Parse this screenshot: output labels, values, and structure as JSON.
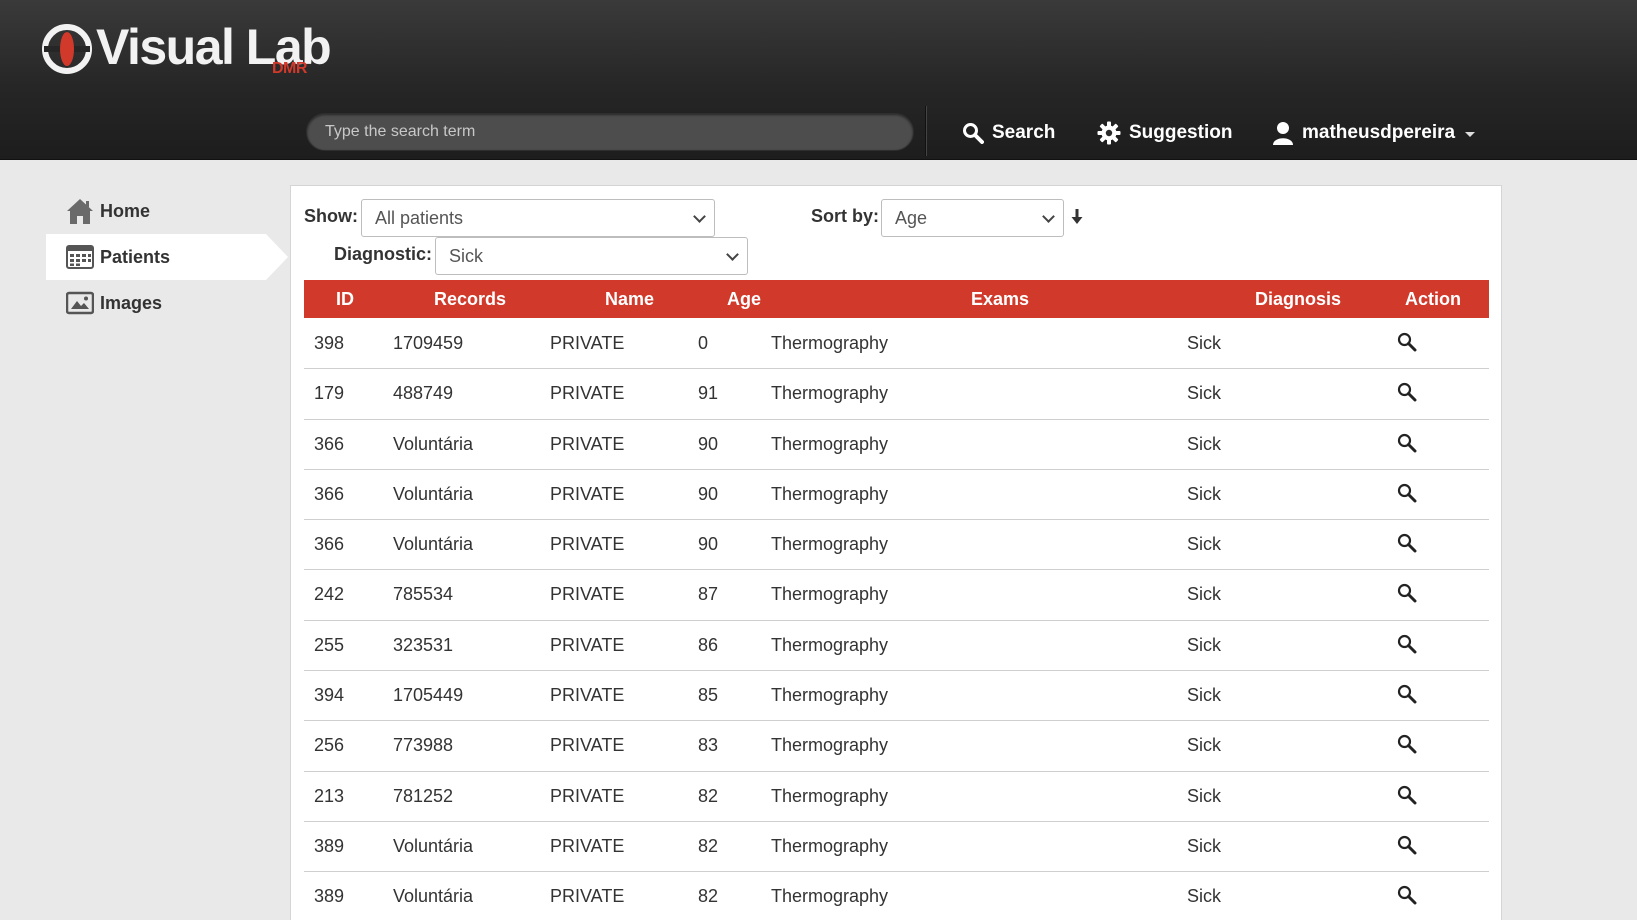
{
  "header": {
    "logo_text": "Visual Lab",
    "logo_sub": "DMR",
    "search_placeholder": "Type the search term",
    "nav": {
      "search_label": "Search",
      "suggestion_label": "Suggestion",
      "user_label": "matheusdpereira"
    }
  },
  "sidebar": {
    "items": [
      {
        "label": "Home",
        "icon": "home-icon"
      },
      {
        "label": "Patients",
        "icon": "calendar-icon",
        "active": true
      },
      {
        "label": "Images",
        "icon": "image-icon"
      }
    ]
  },
  "filters": {
    "show_label": "Show:",
    "show_value": "All patients",
    "sort_label": "Sort by:",
    "sort_value": "Age",
    "diagnostic_label": "Diagnostic:",
    "diagnostic_value": "Sick"
  },
  "table": {
    "columns": [
      "ID",
      "Records",
      "Name",
      "Age",
      "Exams",
      "Diagnosis",
      "Action"
    ],
    "rows": [
      {
        "id": "398",
        "records": "1709459",
        "name": "PRIVATE",
        "age": "0",
        "exams": "Thermography",
        "diagnosis": "Sick"
      },
      {
        "id": "179",
        "records": "488749",
        "name": "PRIVATE",
        "age": "91",
        "exams": "Thermography",
        "diagnosis": "Sick"
      },
      {
        "id": "366",
        "records": "Voluntária",
        "name": "PRIVATE",
        "age": "90",
        "exams": "Thermography",
        "diagnosis": "Sick"
      },
      {
        "id": "366",
        "records": "Voluntária",
        "name": "PRIVATE",
        "age": "90",
        "exams": "Thermography",
        "diagnosis": "Sick"
      },
      {
        "id": "366",
        "records": "Voluntária",
        "name": "PRIVATE",
        "age": "90",
        "exams": "Thermography",
        "diagnosis": "Sick"
      },
      {
        "id": "242",
        "records": "785534",
        "name": "PRIVATE",
        "age": "87",
        "exams": "Thermography",
        "diagnosis": "Sick"
      },
      {
        "id": "255",
        "records": "323531",
        "name": "PRIVATE",
        "age": "86",
        "exams": "Thermography",
        "diagnosis": "Sick"
      },
      {
        "id": "394",
        "records": "1705449",
        "name": "PRIVATE",
        "age": "85",
        "exams": "Thermography",
        "diagnosis": "Sick"
      },
      {
        "id": "256",
        "records": "773988",
        "name": "PRIVATE",
        "age": "83",
        "exams": "Thermography",
        "diagnosis": "Sick"
      },
      {
        "id": "213",
        "records": "781252",
        "name": "PRIVATE",
        "age": "82",
        "exams": "Thermography",
        "diagnosis": "Sick"
      },
      {
        "id": "389",
        "records": "Voluntária",
        "name": "PRIVATE",
        "age": "82",
        "exams": "Thermography",
        "diagnosis": "Sick"
      },
      {
        "id": "389",
        "records": "Voluntária",
        "name": "PRIVATE",
        "age": "82",
        "exams": "Thermography",
        "diagnosis": "Sick"
      }
    ]
  },
  "colors": {
    "accent": "#d1392b",
    "header_bg": "#262626",
    "page_bg": "#e9e9e9"
  }
}
